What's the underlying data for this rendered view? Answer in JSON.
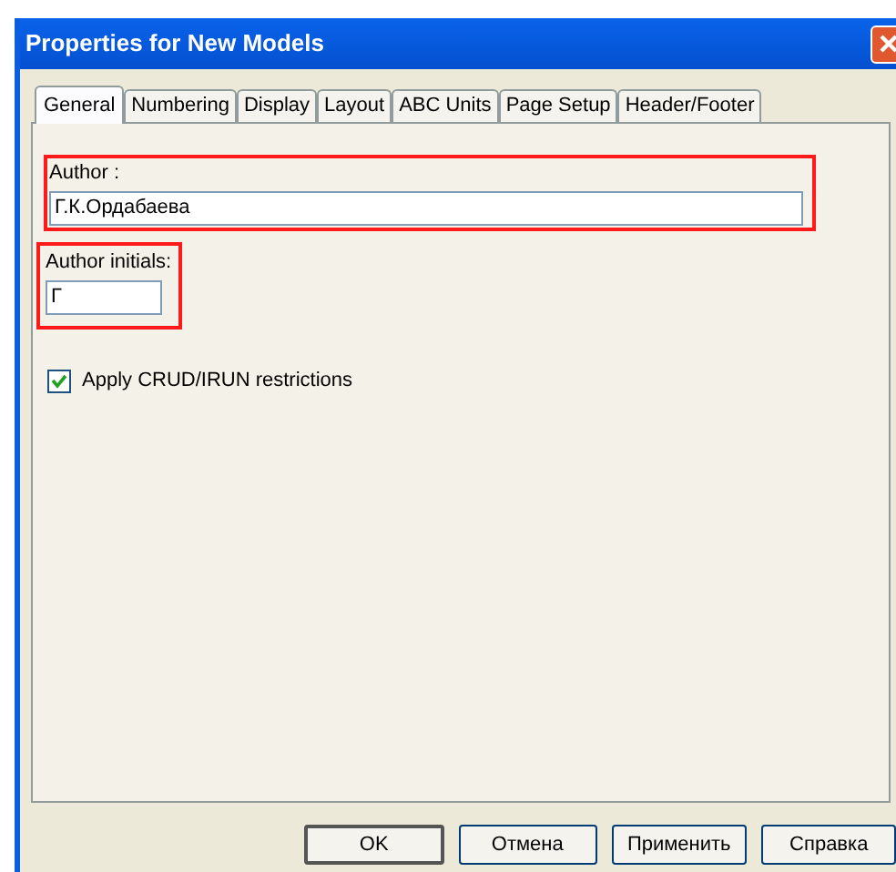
{
  "window": {
    "title": "Properties for New Models"
  },
  "tabs": [
    {
      "label": "General",
      "selected": true
    },
    {
      "label": "Numbering",
      "selected": false
    },
    {
      "label": "Display",
      "selected": false
    },
    {
      "label": "Layout",
      "selected": false
    },
    {
      "label": "ABC Units",
      "selected": false
    },
    {
      "label": "Page Setup",
      "selected": false
    },
    {
      "label": "Header/Footer",
      "selected": false
    }
  ],
  "author": {
    "label": "Author :",
    "value": "Г.К.Ордабаева",
    "highlighted": true
  },
  "author_initials": {
    "label": "Author initials:",
    "value": "Г",
    "highlighted": true
  },
  "apply_restrictions": {
    "label": "Apply CRUD/IRUN restrictions",
    "checked": true
  },
  "buttons": [
    {
      "label": "OK",
      "default": true
    },
    {
      "label": "Отмена",
      "default": false
    },
    {
      "label": "Применить",
      "default": false
    },
    {
      "label": "Справка",
      "default": false
    }
  ]
}
